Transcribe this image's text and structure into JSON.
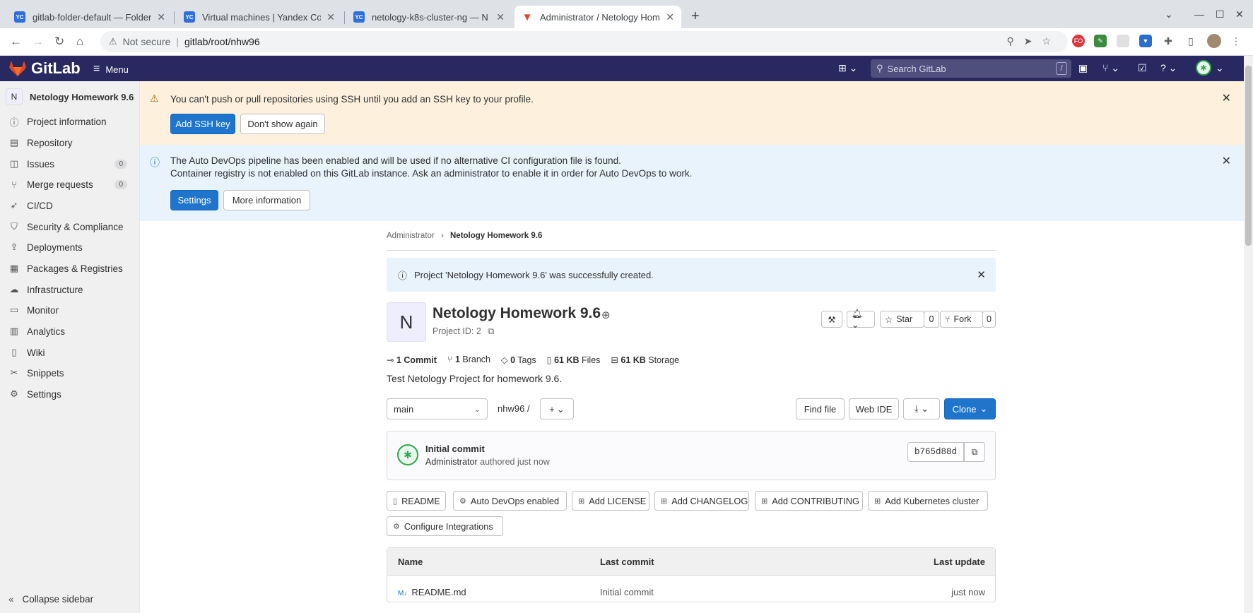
{
  "browser": {
    "tabs": [
      {
        "title": "gitlab-folder-default — Folder",
        "favicon": "YC",
        "active": false
      },
      {
        "title": "Virtual machines | Yandex Com",
        "favicon": "YC",
        "active": false
      },
      {
        "title": "netology-k8s-cluster-ng — N",
        "favicon": "YC",
        "active": false
      },
      {
        "title": "Administrator / Netology Hom",
        "favicon": "gitlab-icon",
        "active": true
      }
    ],
    "address": {
      "security": "Not secure",
      "url": "gitlab/root/nhw96"
    }
  },
  "header": {
    "brand": "GitLab",
    "menu_label": "Menu",
    "search_placeholder": "Search GitLab",
    "search_shortcut": "/"
  },
  "sidebar": {
    "project_initial": "N",
    "project_name": "Netology Homework 9.6",
    "items": [
      {
        "label": "Project information",
        "icon": "info-icon"
      },
      {
        "label": "Repository",
        "icon": "doc-icon"
      },
      {
        "label": "Issues",
        "icon": "issues-icon",
        "count": "0"
      },
      {
        "label": "Merge requests",
        "icon": "merge-icon",
        "count": "0"
      },
      {
        "label": "CI/CD",
        "icon": "rocket-icon"
      },
      {
        "label": "Security & Compliance",
        "icon": "shield-icon"
      },
      {
        "label": "Deployments",
        "icon": "deploy-icon"
      },
      {
        "label": "Packages & Registries",
        "icon": "package-icon"
      },
      {
        "label": "Infrastructure",
        "icon": "cloud-icon"
      },
      {
        "label": "Monitor",
        "icon": "monitor-icon"
      },
      {
        "label": "Analytics",
        "icon": "chart-icon"
      },
      {
        "label": "Wiki",
        "icon": "book-icon"
      },
      {
        "label": "Snippets",
        "icon": "snippet-icon"
      },
      {
        "label": "Settings",
        "icon": "gear-icon"
      }
    ],
    "collapse_label": "Collapse sidebar"
  },
  "alerts": {
    "ssh": {
      "text": "You can't push or pull repositories using SSH until you add an SSH key to your profile.",
      "primary": "Add SSH key",
      "secondary": "Don't show again"
    },
    "devops": {
      "line1": "The Auto DevOps pipeline has been enabled and will be used if no alternative CI configuration file is found.",
      "line2": "Container registry is not enabled on this GitLab instance. Ask an administrator to enable it in order for Auto DevOps to work.",
      "primary": "Settings",
      "secondary": "More information"
    }
  },
  "breadcrumb": {
    "parent": "Administrator",
    "current": "Netology Homework 9.6"
  },
  "flash": "Project 'Netology Homework 9.6' was successfully created.",
  "project": {
    "initial": "N",
    "title": "Netology Homework 9.6",
    "id": "Project ID: 2",
    "star_label": "Star",
    "star_count": "0",
    "fork_label": "Fork",
    "fork_count": "0",
    "stats": {
      "commits_n": "1",
      "commits": "Commit",
      "branches_n": "1",
      "branches": "Branch",
      "tags_n": "0",
      "tags": "Tags",
      "files_n": "61 KB",
      "files": "Files",
      "storage_n": "61 KB",
      "storage": "Storage"
    },
    "description": "Test Netology Project for homework 9.6."
  },
  "repo_nav": {
    "branch": "main",
    "path": "nhw96",
    "path_sep": "/",
    "find_file": "Find file",
    "web_ide": "Web IDE",
    "clone": "Clone"
  },
  "commit": {
    "title": "Initial commit",
    "author": "Administrator",
    "authored": "authored just now",
    "sha": "b765d88d"
  },
  "shortcuts": [
    {
      "label": "README",
      "icon": "doc-icon"
    },
    {
      "label": "Auto DevOps enabled",
      "icon": "gear-icon"
    },
    {
      "label": "Add LICENSE",
      "icon": "plus-square-icon"
    },
    {
      "label": "Add CHANGELOG",
      "icon": "plus-square-icon"
    },
    {
      "label": "Add CONTRIBUTING",
      "icon": "plus-square-icon"
    },
    {
      "label": "Add Kubernetes cluster",
      "icon": "plus-square-icon"
    },
    {
      "label": "Configure Integrations",
      "icon": "gear-icon"
    }
  ],
  "file_table": {
    "headers": [
      "Name",
      "Last commit",
      "Last update"
    ],
    "rows": [
      {
        "name": "README.md",
        "commit": "Initial commit",
        "updated": "just now"
      }
    ]
  },
  "colors": {
    "header_bg": "#292961",
    "primary": "#1f75cb",
    "warning_bg": "#fdf1dd",
    "info_bg": "#e9f3fc"
  }
}
